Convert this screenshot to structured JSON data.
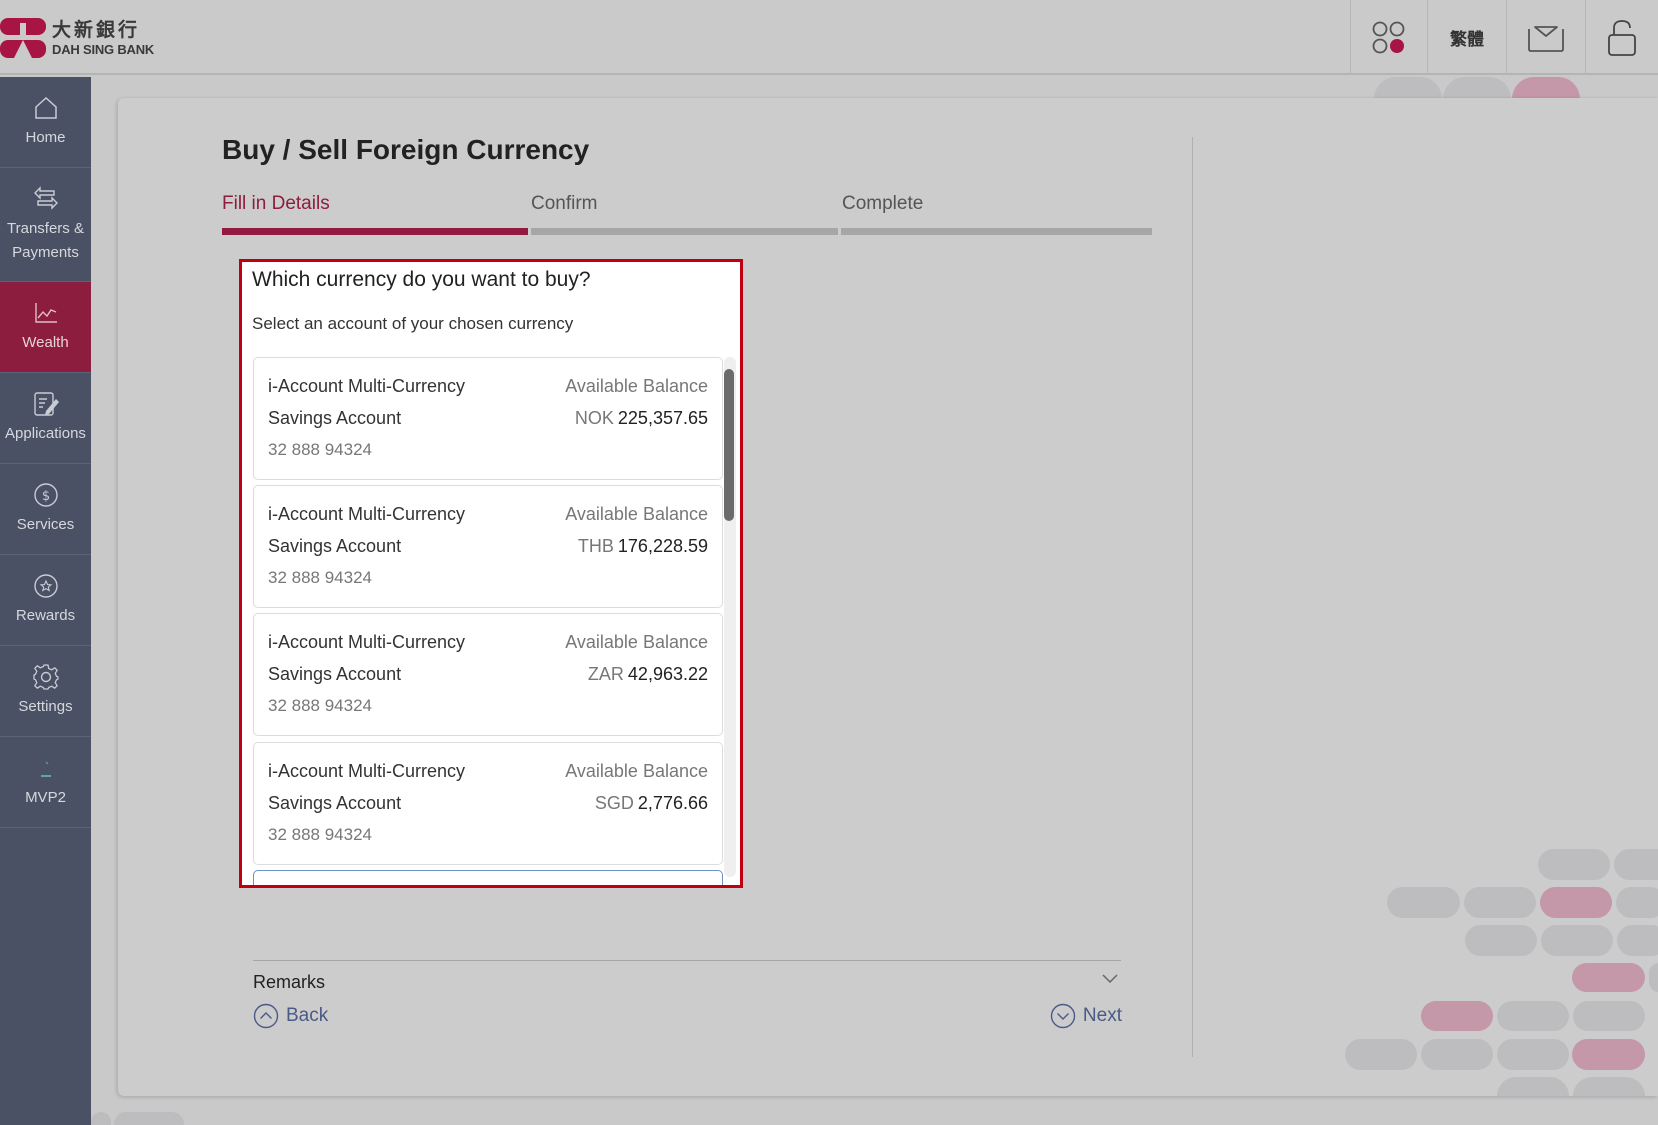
{
  "brand": {
    "name_cn": "大新銀行",
    "name_en": "DAH SING BANK",
    "color": "#8d1d3e"
  },
  "header": {
    "apps_icon": "apps-grid-icon",
    "language_label": "繁體",
    "mail_icon": "mail-icon",
    "lock_icon": "logout-lock-icon"
  },
  "sidebar": {
    "items": [
      {
        "label": "Home",
        "icon": "home-icon",
        "active": false
      },
      {
        "label": "Transfers & Payments",
        "icon": "transfer-arrows-icon",
        "active": false
      },
      {
        "label": "Wealth",
        "icon": "chart-line-icon",
        "active": true
      },
      {
        "label": "Applications",
        "icon": "form-edit-icon",
        "active": false
      },
      {
        "label": "Services",
        "icon": "dollar-circle-icon",
        "active": false
      },
      {
        "label": "Rewards",
        "icon": "star-circle-icon",
        "active": false
      },
      {
        "label": "Settings",
        "icon": "gear-icon",
        "active": false
      },
      {
        "label": "MVP2",
        "icon": "mvp-icon",
        "active": false
      }
    ]
  },
  "main": {
    "title": "Buy / Sell Foreign Currency",
    "steps": [
      {
        "label": "Fill in Details",
        "active": true
      },
      {
        "label": "Confirm",
        "active": false
      },
      {
        "label": "Complete",
        "active": false
      }
    ],
    "question": "Which currency do you want to buy?",
    "instruction": "Select an account of your chosen currency",
    "accounts": [
      {
        "name_line1": "i-Account Multi-Currency",
        "name_line2": "Savings Account",
        "number": "32 888 94324",
        "balance_label": "Available Balance",
        "currency": "NOK",
        "amount": "225,357.65"
      },
      {
        "name_line1": "i-Account Multi-Currency",
        "name_line2": "Savings Account",
        "number": "32 888 94324",
        "balance_label": "Available Balance",
        "currency": "THB",
        "amount": "176,228.59"
      },
      {
        "name_line1": "i-Account Multi-Currency",
        "name_line2": "Savings Account",
        "number": "32 888 94324",
        "balance_label": "Available Balance",
        "currency": "ZAR",
        "amount": "42,963.22"
      },
      {
        "name_line1": "i-Account Multi-Currency",
        "name_line2": "Savings Account",
        "number": "32 888 94324",
        "balance_label": "Available Balance",
        "currency": "SGD",
        "amount": "2,776.66"
      }
    ],
    "remarks_label": "Remarks",
    "back_label": "Back",
    "next_label": "Next"
  }
}
